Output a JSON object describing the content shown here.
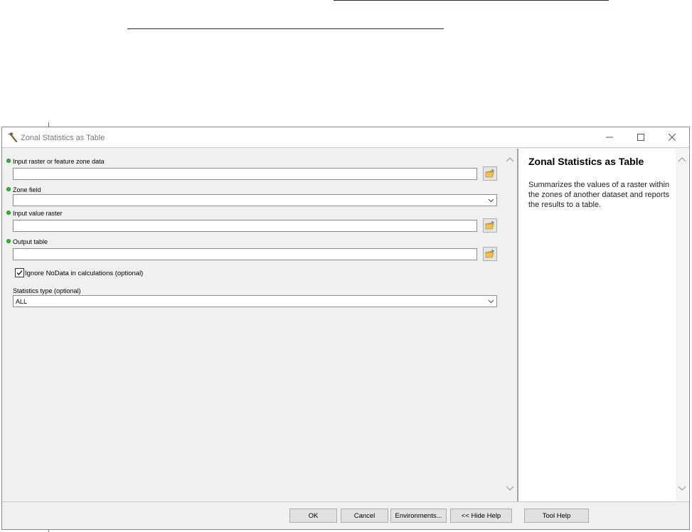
{
  "window": {
    "title": "Zonal Statistics as Table",
    "controls": {
      "minimize_icon": "minimize-icon",
      "maximize_icon": "maximize-icon",
      "close_icon": "close-icon"
    }
  },
  "form": {
    "input_zone": {
      "label": "Input raster or feature zone data",
      "value": "",
      "required": true
    },
    "zone_field": {
      "label": "Zone field",
      "value": "",
      "required": true
    },
    "input_value_raster": {
      "label": "Input value raster",
      "value": "",
      "required": true
    },
    "output_table": {
      "label": "Output table",
      "value": "",
      "required": true
    },
    "ignore_nodata": {
      "label": "Ignore NoData in calculations (optional)",
      "checked": true
    },
    "statistics_type": {
      "label": "Statistics type (optional)",
      "value": "ALL"
    }
  },
  "help": {
    "title": "Zonal Statistics as Table",
    "description": "Summarizes the values of a raster within the zones of another dataset and reports the results to a table."
  },
  "buttons": {
    "ok": "OK",
    "cancel": "Cancel",
    "environments": "Environments...",
    "hide_help": "<< Hide Help",
    "tool_help": "Tool Help"
  },
  "colors": {
    "required_dot": "#27c227",
    "window_bg": "#f0f0f0",
    "doc_line": "#1f2a44"
  }
}
